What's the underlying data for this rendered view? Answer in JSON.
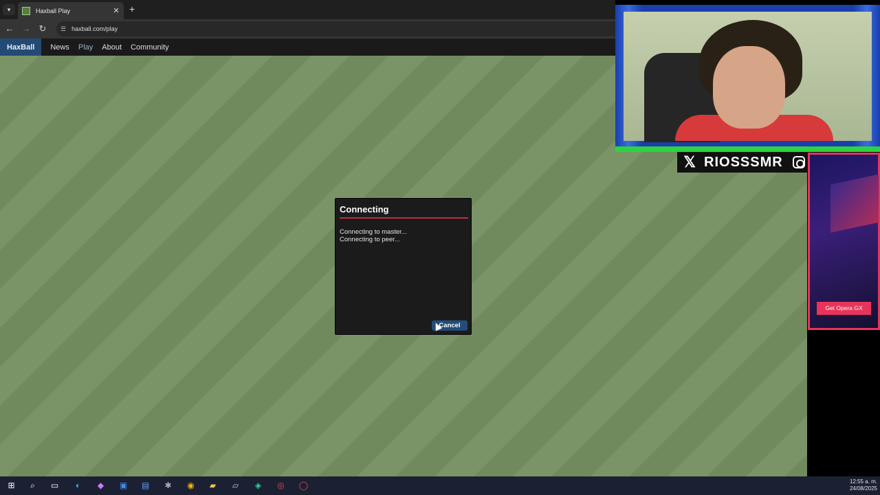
{
  "browser": {
    "tab_title": "Haxball Play",
    "url": "haxball.com/play"
  },
  "site_nav": {
    "brand": "HaxBall",
    "links": [
      "News",
      "Play",
      "About",
      "Community"
    ],
    "active": "Play"
  },
  "dialog": {
    "title": "Connecting",
    "messages": [
      "Connecting to master...",
      "Connecting to peer..."
    ],
    "cancel_label": "Cancel",
    "accent_color": "#c22e39"
  },
  "overlay": {
    "social_handle": "RIOSSSMR",
    "ad_button": "Get Opera GX"
  },
  "taskbar": {
    "time": "12:55 a. m.",
    "date": "24/08/2025"
  }
}
